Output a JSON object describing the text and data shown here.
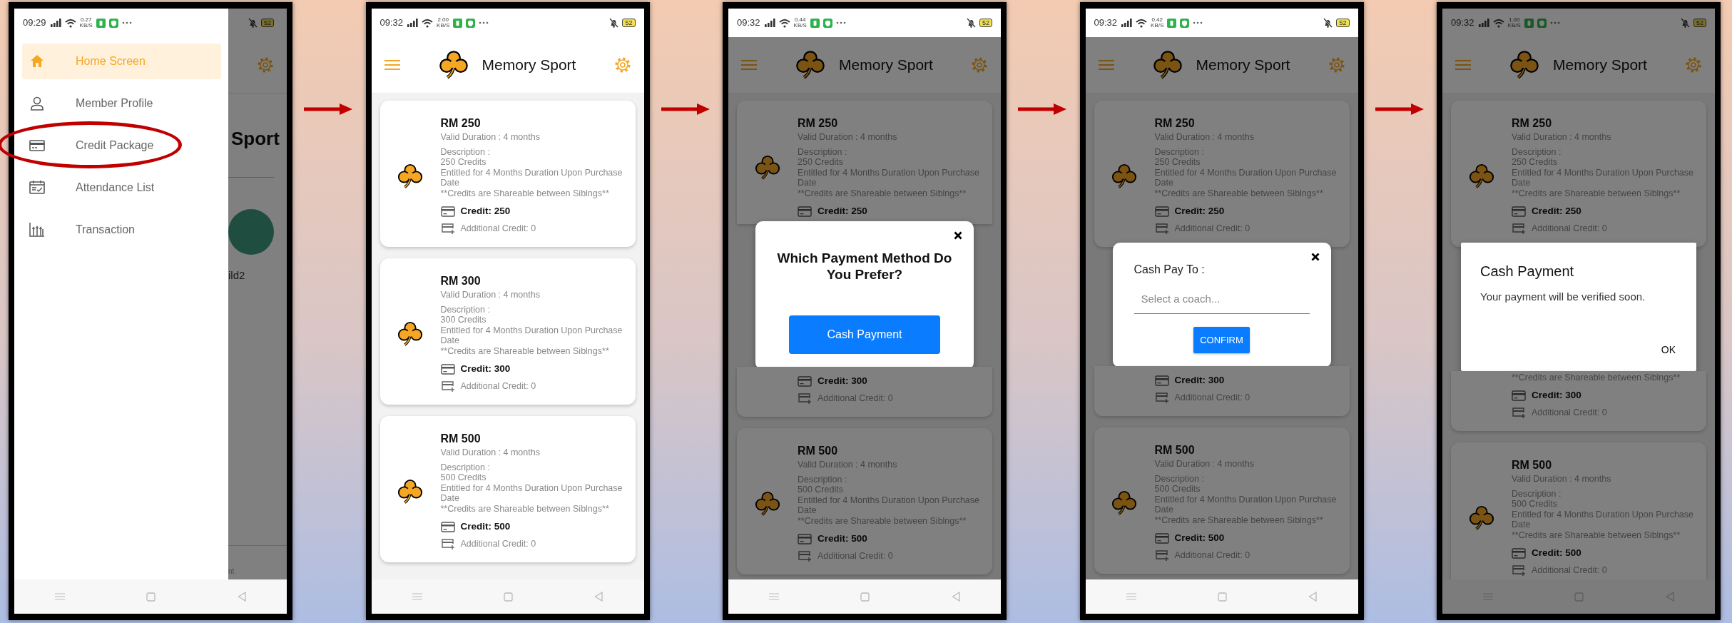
{
  "screens": [
    {
      "kind": "drawer",
      "status_bar": {
        "time": "09:29",
        "speed": "0.27",
        "speed_unit": "KB/S",
        "battery": "52"
      },
      "menu": [
        {
          "label": "Home Screen",
          "selected": true,
          "circled": false
        },
        {
          "label": "Member Profile",
          "selected": false,
          "circled": false
        },
        {
          "label": "Credit Package",
          "selected": false,
          "circled": true
        },
        {
          "label": "Attendance List",
          "selected": false,
          "circled": false
        },
        {
          "label": "Transaction",
          "selected": false,
          "circled": false
        }
      ],
      "background": {
        "title": "Sport",
        "caption": "ild2",
        "footer": "nt"
      }
    },
    {
      "kind": "packages",
      "status_bar": {
        "time": "09:32",
        "speed": "2.00",
        "speed_unit": "KB/S",
        "battery": "52"
      },
      "title": "Memory Sport",
      "packages": [
        {
          "price": "RM 250",
          "duration": "Valid Duration : 4 months",
          "description_label": "Description :",
          "description": [
            "250 Credits",
            "Entitled for 4 Months Duration Upon Purchase Date",
            "**Credits are Shareable between Siblngs**"
          ],
          "credit": "Credit: 250",
          "additional": "Additional Credit: 0"
        },
        {
          "price": "RM 300",
          "duration": "Valid Duration : 4 months",
          "description_label": "Description :",
          "description": [
            "300 Credits",
            "Entitled for 4 Months Duration Upon Purchase Date",
            "**Credits are Shareable between Siblngs**"
          ],
          "credit": "Credit: 300",
          "additional": "Additional Credit: 0"
        },
        {
          "price": "RM 500",
          "duration": "Valid Duration : 4 months",
          "description_label": "Description :",
          "description": [
            "500 Credits",
            "Entitled for 4 Months Duration Upon Purchase Date",
            "**Credits are Shareable between Siblngs**"
          ],
          "credit": "Credit: 500",
          "additional": "Additional Credit: 0"
        }
      ]
    },
    {
      "kind": "packages",
      "dimmed": true,
      "status_bar": {
        "time": "09:32",
        "speed": "0.44",
        "speed_unit": "KB/S",
        "battery": "52"
      },
      "title": "Memory Sport",
      "packages": [
        {
          "price": "RM 250",
          "duration": "Valid Duration : 4 months",
          "description_label": "Description :",
          "description": [
            "250 Credits",
            "Entitled for 4 Months Duration Upon Purchase Date",
            "**Credits are Shareable between Siblngs**"
          ],
          "credit": "Credit: 250"
        },
        {
          "credit": "Credit: 300",
          "additional": "Additional Credit: 0"
        },
        {
          "price": "RM 500",
          "duration": "Valid Duration : 4 months",
          "description_label": "Description :",
          "description": [
            "500 Credits",
            "Entitled for 4 Months Duration Upon Purchase Date",
            "**Credits are Shareable between Siblngs**"
          ],
          "credit": "Credit: 500",
          "additional": "Additional Credit: 0"
        }
      ],
      "dialog": {
        "kind": "choice",
        "title": "Which Payment Method Do You Prefer?",
        "button": "Cash Payment"
      }
    },
    {
      "kind": "packages",
      "dimmed": true,
      "status_bar": {
        "time": "09:32",
        "speed": "0.42",
        "speed_unit": "KB/S",
        "battery": "52"
      },
      "title": "Memory Sport",
      "packages": [
        {
          "price": "RM 250",
          "duration": "Valid Duration : 4 months",
          "description_label": "Description :",
          "description": [
            "250 Credits",
            "Entitled for 4 Months Duration Upon Purchase Date",
            "**Credits are Shareable between Siblngs**"
          ],
          "credit": "Credit: 250",
          "additional": "Additional Credit: 0"
        },
        {
          "credit": "Credit: 300",
          "additional": "Additional Credit: 0"
        },
        {
          "price": "RM 500",
          "duration": "Valid Duration : 4 months",
          "description_label": "Description :",
          "description": [
            "500 Credits",
            "Entitled for 4 Months Duration Upon Purchase Date",
            "**Credits are Shareable between Siblngs**"
          ],
          "credit": "Credit: 500",
          "additional": "Additional Credit: 0"
        }
      ],
      "dialog": {
        "kind": "form",
        "label": "Cash Pay To :",
        "placeholder": "Select a coach...",
        "button": "CONFIRM"
      }
    },
    {
      "kind": "packages",
      "dimmed": true,
      "system_bars_dimmed": true,
      "status_bar": {
        "time": "09:32",
        "speed": "1.00",
        "speed_unit": "KB/S",
        "battery": "52"
      },
      "title": "Memory Sport",
      "packages": [
        {
          "price": "RM 250",
          "duration": "Valid Duration : 4 months",
          "description_label": "Description :",
          "description": [
            "250 Credits",
            "Entitled for 4 Months Duration Upon Purchase Date",
            "**Credits are Shareable between Siblngs**"
          ],
          "credit": "Credit: 250",
          "additional": "Additional Credit: 0"
        },
        {
          "description": [
            "**Credits are Shareable between Siblngs**"
          ],
          "credit": "Credit: 300",
          "additional": "Additional Credit: 0"
        },
        {
          "price": "RM 500",
          "duration": "Valid Duration : 4 months",
          "description_label": "Description :",
          "description": [
            "500 Credits",
            "Entitled for 4 Months Duration Upon Purchase Date",
            "**Credits are Shareable between Siblngs**"
          ],
          "credit": "Credit: 500",
          "additional": "Additional Credit: 0"
        }
      ],
      "dialog": {
        "kind": "alert",
        "title": "Cash Payment",
        "message": "Your payment will be verified soon.",
        "button": "OK"
      }
    }
  ]
}
